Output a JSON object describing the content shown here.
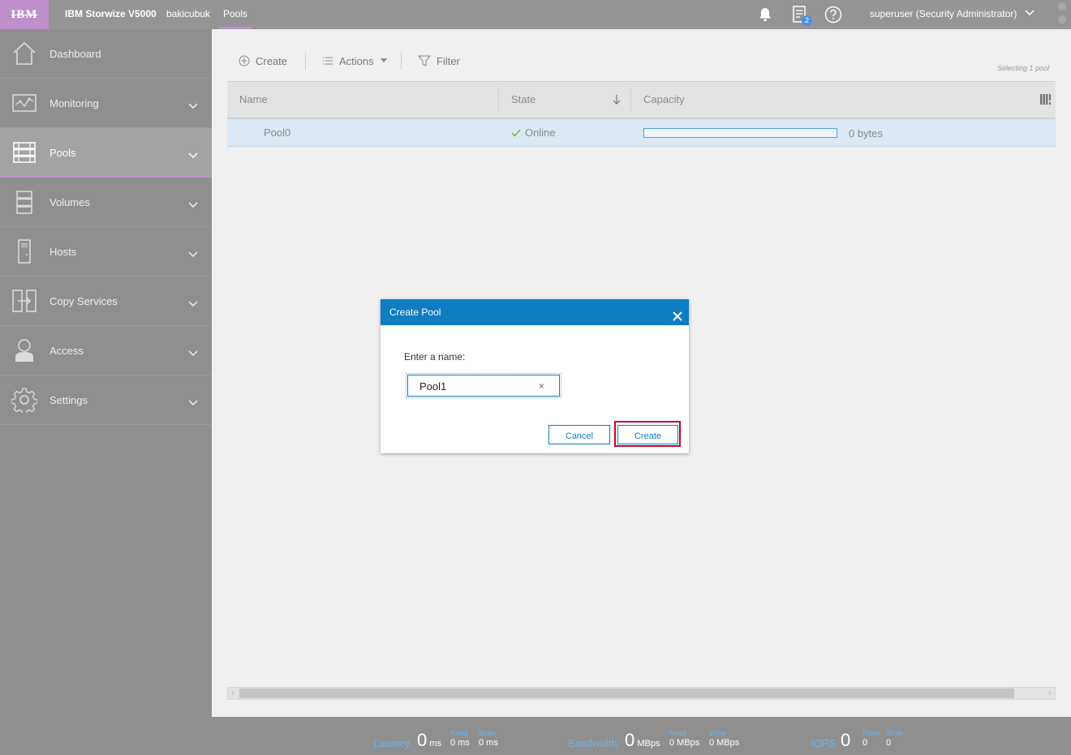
{
  "topbar": {
    "logo_text": "IBM",
    "product": "IBM Storwize V5000",
    "system_name": "bakicubuk",
    "breadcrumb": "Pools",
    "tasks_badge": "2",
    "user": "superuser (Security Administrator)"
  },
  "sidebar": {
    "items": [
      {
        "label": "Dashboard",
        "icon": "home-icon"
      },
      {
        "label": "Monitoring",
        "icon": "monitoring-icon"
      },
      {
        "label": "Pools",
        "icon": "pools-icon",
        "active": true
      },
      {
        "label": "Volumes",
        "icon": "volumes-icon"
      },
      {
        "label": "Hosts",
        "icon": "hosts-icon"
      },
      {
        "label": "Copy Services",
        "icon": "copy-services-icon"
      },
      {
        "label": "Access",
        "icon": "access-icon"
      },
      {
        "label": "Settings",
        "icon": "gear-icon"
      }
    ]
  },
  "toolbar": {
    "create_label": "Create",
    "actions_label": "Actions",
    "filter_label": "Filter",
    "selecting_text": "Selecting 1 pool"
  },
  "table": {
    "columns": [
      "Name",
      "State",
      "Capacity"
    ],
    "rows": [
      {
        "name": "Pool0",
        "state": "Online",
        "capacity": "0 bytes",
        "capacity_fraction": 0
      }
    ]
  },
  "statusbar": {
    "latency": {
      "label": "Latency",
      "value": "0",
      "unit": "ms",
      "read_label": "Read",
      "read": "0 ms",
      "write_label": "Write",
      "write": "0 ms"
    },
    "bandwidth": {
      "label": "Bandwidth",
      "value": "0",
      "unit": "MBps",
      "read_label": "Read",
      "read": "0 MBps",
      "write_label": "Write",
      "write": "0 MBps"
    },
    "iops": {
      "label": "IOPS",
      "value": "0",
      "read_label": "Read",
      "read": "0",
      "write_label": "Write",
      "write": "0"
    }
  },
  "dialog": {
    "title": "Create Pool",
    "prompt": "Enter a name:",
    "name_value": "Pool1",
    "cancel_label": "Cancel",
    "create_label": "Create"
  },
  "colors": {
    "accent": "#bf8fcc",
    "dialog_header": "#0f7dc2",
    "status_ok": "#7ab648",
    "highlight": "#d0021b"
  }
}
